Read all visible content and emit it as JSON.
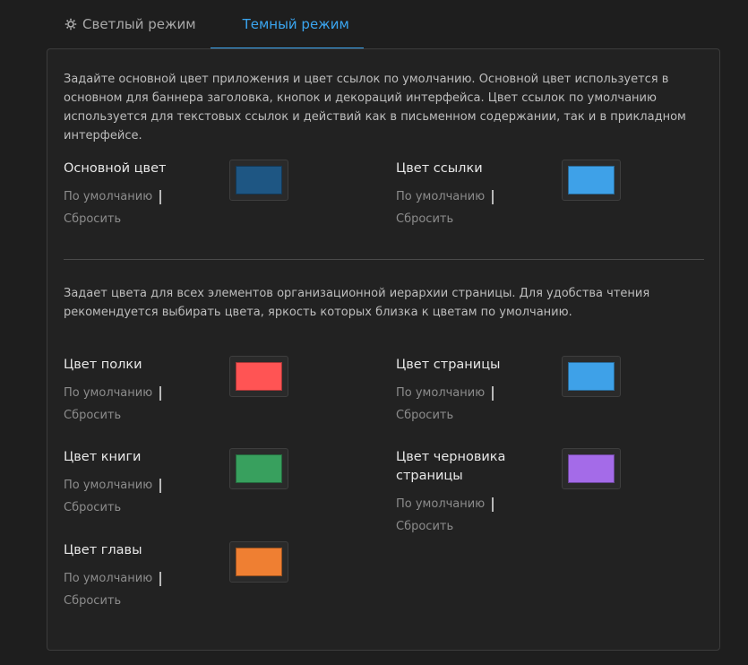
{
  "tabs": [
    {
      "label": "Светлый режим",
      "icon": "gear-icon",
      "active": false
    },
    {
      "label": "Темный режим",
      "icon": "moon-icon",
      "active": true
    }
  ],
  "section1": {
    "description": "Задайте основной цвет приложения и цвет ссылок по умолчанию. Основной цвет используется в основном для баннера заголовка, кнопок и декораций интерфейса. Цвет ссылок по умолчанию используется для текстовых ссылок и действий как в письменном содержании, так и в прикладном интерфейсе.",
    "items": [
      {
        "label": "Основной цвет",
        "default_label": "По умолчанию",
        "reset_label": "Сбросить",
        "color": "#1e5683"
      },
      {
        "label": "Цвет ссылки",
        "default_label": "По умолчанию",
        "reset_label": "Сбросить",
        "color": "#3ea1e8"
      }
    ]
  },
  "section2": {
    "description": "Задает цвета для всех элементов организационной иерархии страницы. Для удобства чтения рекомендуется выбирать цвета, яркость которых близка к цветам по умолчанию.",
    "items": [
      {
        "label": "Цвет полки",
        "default_label": "По умолчанию",
        "reset_label": "Сбросить",
        "color": "#ff5454"
      },
      {
        "label": "Цвет страницы",
        "default_label": "По умолчанию",
        "reset_label": "Сбросить",
        "color": "#3ea1e8"
      },
      {
        "label": "Цвет книги",
        "default_label": "По умолчанию",
        "reset_label": "Сбросить",
        "color": "#38a05e"
      },
      {
        "label": "Цвет черновика страницы",
        "default_label": "По умолчанию",
        "reset_label": "Сбросить",
        "color": "#a46be8"
      },
      {
        "label": "Цвет главы",
        "default_label": "По умолчанию",
        "reset_label": "Сбросить",
        "color": "#ef7f32"
      }
    ]
  },
  "theme": {
    "accent": "#3aa5f0",
    "background": "#1e1e1e",
    "panel": "#222222"
  }
}
